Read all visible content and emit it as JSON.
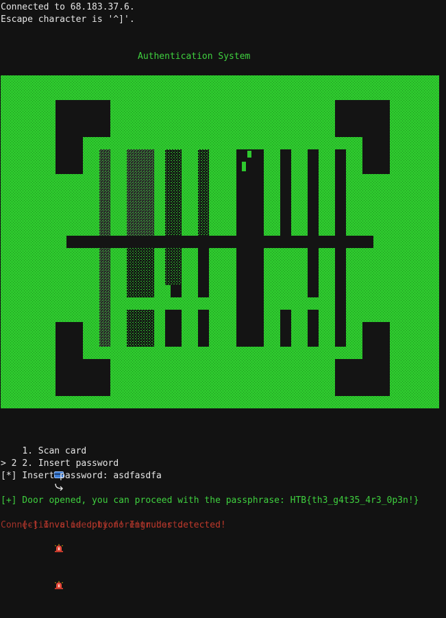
{
  "terminal": {
    "connected_line": "Connected to 68.183.37.6.",
    "escape_line": "Escape character is '^]'.",
    "banner_title": "Authentication System",
    "menu_item_1": "1. Scan card",
    "menu_item_1_icon": "credit-card-icon",
    "menu_item_2": "2. Insert password",
    "menu_item_2_icon": "return-arrow-icon",
    "user_choice": "> 2",
    "insert_password_prompt": "[*] Insert password: asdfasdfa",
    "door_opened_line": "[+] Door opened, you can proceed with the passphrase: HTB{th3_g4t35_4r3_0p3n!}",
    "invalid_option_line": "[-] Invalid option! Intruder detected!",
    "alarm_icon": "siren-icon",
    "closed_line": "Connection closed by foreign host."
  },
  "colors": {
    "background": "#121212",
    "foreground": "#e6e6e6",
    "ascii_green": "#3fd13f",
    "art_green_bg": "#2ec92e",
    "error_red": "#c0392b"
  }
}
